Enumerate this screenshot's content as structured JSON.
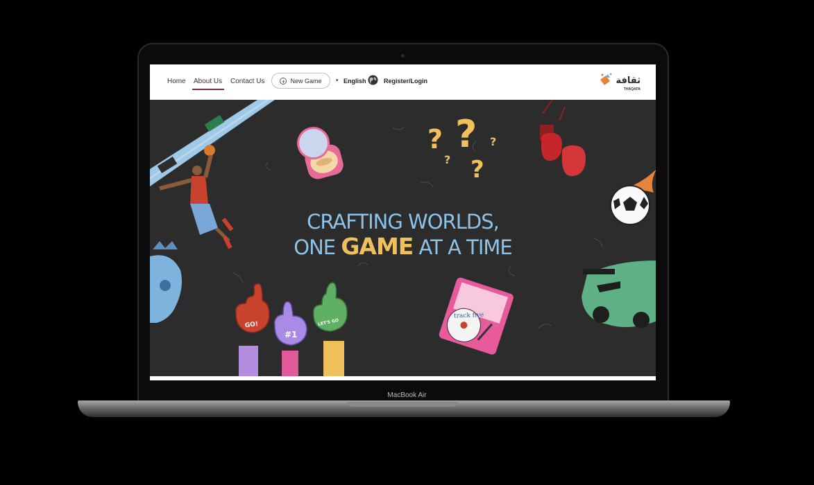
{
  "device": {
    "label": "MacBook Air"
  },
  "nav": {
    "links": [
      {
        "label": "Home"
      },
      {
        "label": "About Us",
        "active": true
      },
      {
        "label": "Contact Us"
      }
    ],
    "new_game_label": "New Game",
    "language_label": "English",
    "register_label": "Register/Login",
    "logo_arabic": "ثقافة",
    "logo_latin": "THAQAFA"
  },
  "hero": {
    "line1": "CRAFTING WORLDS,",
    "line2_pre": "ONE ",
    "line2_highlight": "GAME",
    "line2_post": " AT A TIME",
    "stickers": {
      "foam_hand_1": "GO!",
      "foam_hand_2": "#1",
      "foam_hand_3": "LET'S GO",
      "record_label": "track five"
    }
  },
  "colors": {
    "accent_underline": "#7a2a3a",
    "headline_blue": "#8ec3e8",
    "headline_gold": "#f0c05c",
    "hero_bg": "#2c2c2c"
  }
}
